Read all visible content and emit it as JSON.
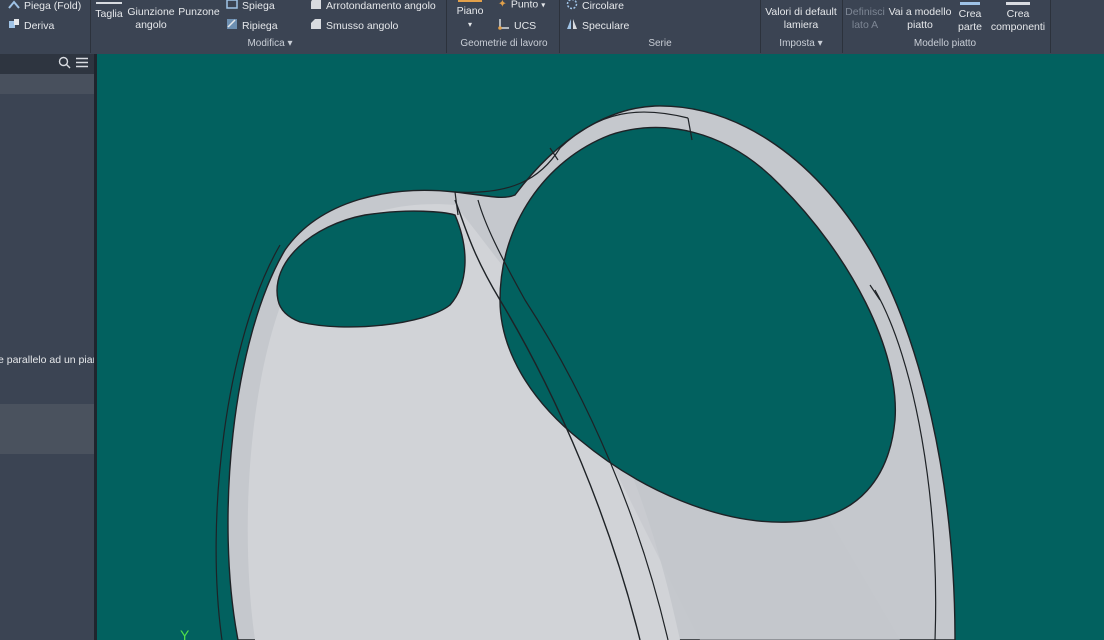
{
  "ribbon": {
    "fold": "Piega (Fold)",
    "derive": "Deriva",
    "cut": "Taglia",
    "corner_seam_1": "Giunzione",
    "corner_seam_2": "angolo",
    "punch": "Punzone",
    "unfold": "Spiega",
    "refold": "Ripiega",
    "corner_round": "Arrotondamento angolo",
    "corner_chamfer": "Smusso angolo",
    "plane": "Piano",
    "point": "Punto",
    "ucs": "UCS",
    "circular": "Circolare",
    "mirror": "Speculare",
    "sheet_defaults_1": "Valori di default",
    "sheet_defaults_2": "lamiera",
    "define_side_1": "Definisci",
    "define_side_2": "lato A",
    "goto_flat_1": "Vai a modello",
    "goto_flat_2": "piatto",
    "create_part_1": "Crea",
    "create_part_2": "parte",
    "create_comp_1": "Crea",
    "create_comp_2": "componenti",
    "group_modify": "Modifica",
    "group_work_features": "Geometrie di lavoro",
    "group_pattern": "Serie",
    "group_setup": "Imposta",
    "group_flat_pattern": "Modello piatto"
  },
  "browser": {
    "tooltip_text": "e parallelo ad un piar"
  },
  "viewport": {
    "axis_label": "Y"
  },
  "colors": {
    "viewport_bg": "#02615f",
    "ribbon_bg": "#3b4453",
    "part_face": "#c9ccd2",
    "part_edge": "#1e2226"
  }
}
